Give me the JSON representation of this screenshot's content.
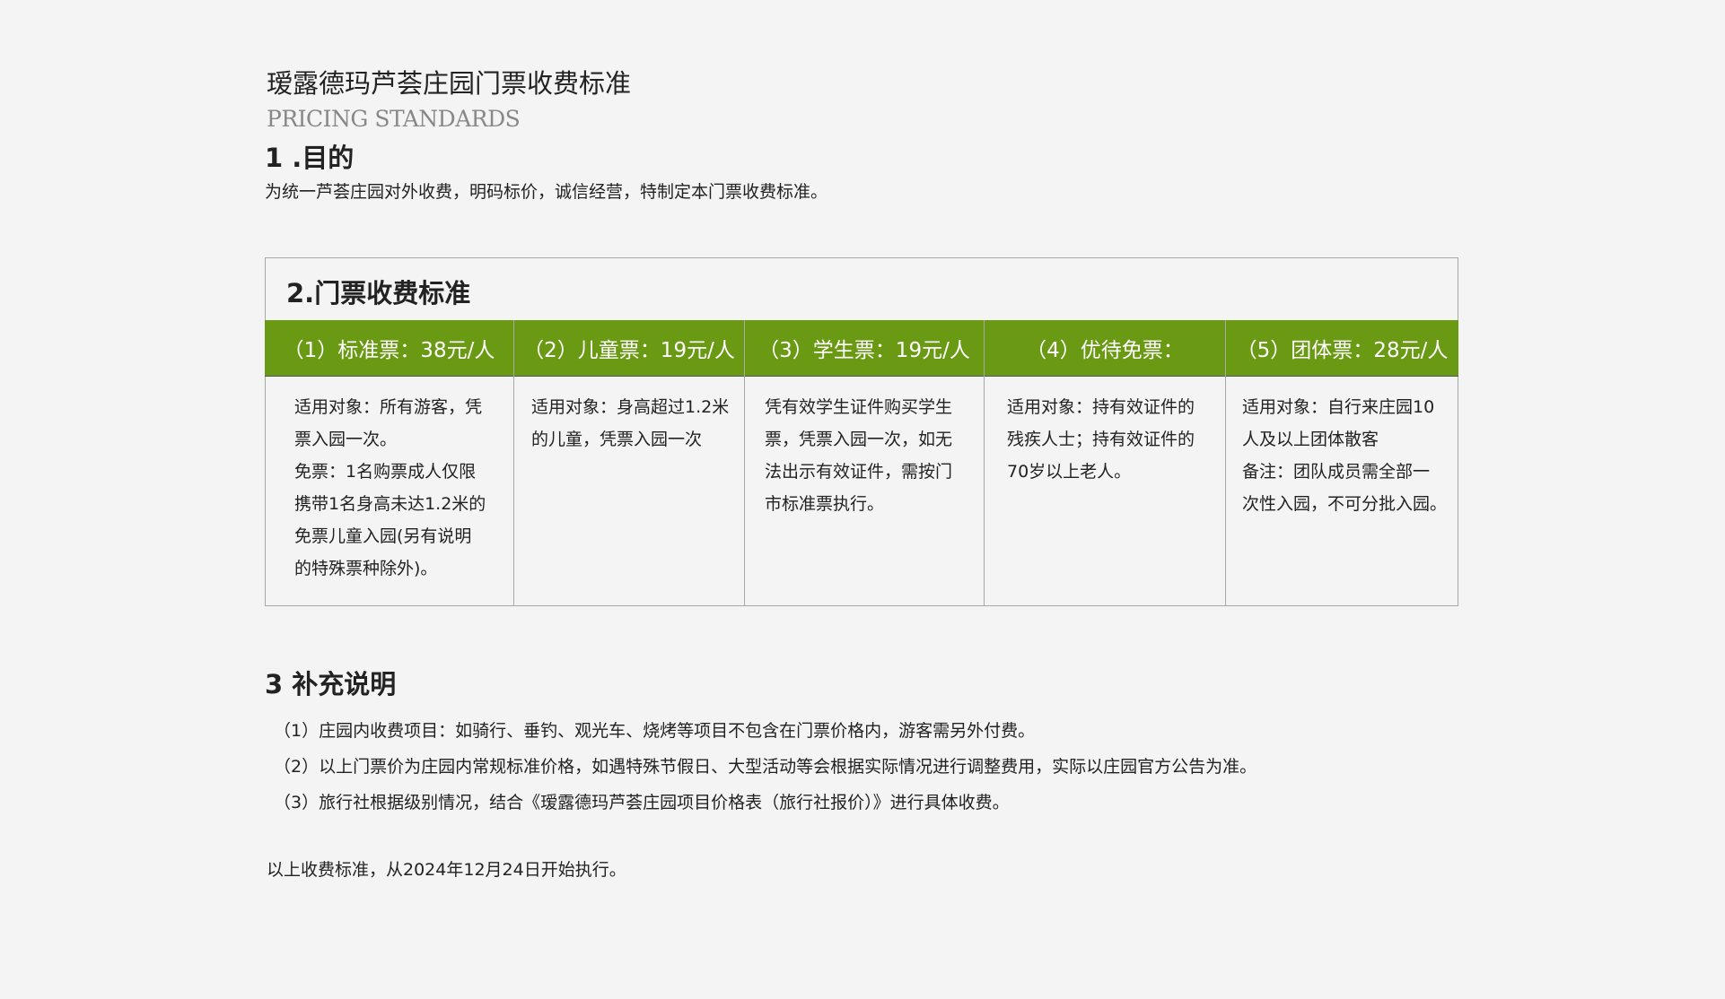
{
  "header": {
    "title": "瑷露德玛芦荟庄园门票收费标准",
    "subtitle": "PRICING STANDARDS"
  },
  "section1": {
    "heading": "1 .目的",
    "text": "为统一芦荟庄园对外收费，明码标价，诚信经营，特制定本门票收费标准。"
  },
  "section2": {
    "heading": "2.门票收费标准",
    "tickets": [
      {
        "label": "（1）标准票：38元/人",
        "lines": [
          "适用对象：所有游客，凭",
          "票入园一次。",
          "免票：1名购票成人仅限",
          "携带1名身高未达1.2米的",
          "免票儿童入园(另有说明",
          "的特殊票种除外)。"
        ]
      },
      {
        "label": "（2）儿童票：19元/人",
        "lines": [
          "适用对象：身高超过1.2米",
          "的儿童，凭票入园一次"
        ]
      },
      {
        "label": "（3）学生票：19元/人",
        "lines": [
          "凭有效学生证件购买学生",
          "票，凭票入园一次，如无",
          "法出示有效证件，需按门",
          "市标准票执行。"
        ]
      },
      {
        "label": "（4）优待免票：",
        "lines": [
          "适用对象：持有效证件的",
          "残疾人士；持有效证件的",
          "70岁以上老人。"
        ]
      },
      {
        "label": "（5）团体票：28元/人",
        "lines": [
          "适用对象：自行来庄园10",
          "人及以上团体散客",
          "备注：团队成员需全部一",
          "次性入园，不可分批入园。"
        ]
      }
    ]
  },
  "section3": {
    "heading": "3 补充说明",
    "items": [
      "（1）庄园内收费项目：如骑行、垂钓、观光车、烧烤等项目不包含在门票价格内，游客需另外付费。",
      "（2）以上门票价为庄园内常规标准价格，如遇特殊节假日、大型活动等会根据实际情况进行调整费用，实际以庄园官方公告为准。",
      "（3）旅行社根据级别情况，结合《瑷露德玛芦荟庄园项目价格表（旅行社报价）》进行具体收费。"
    ]
  },
  "footer": {
    "effective": "以上收费标准，从2024年12月24日开始执行。"
  },
  "colors": {
    "accent_green": "#6a9a14",
    "background": "#f4f4f4",
    "border": "#a8a8a8"
  }
}
